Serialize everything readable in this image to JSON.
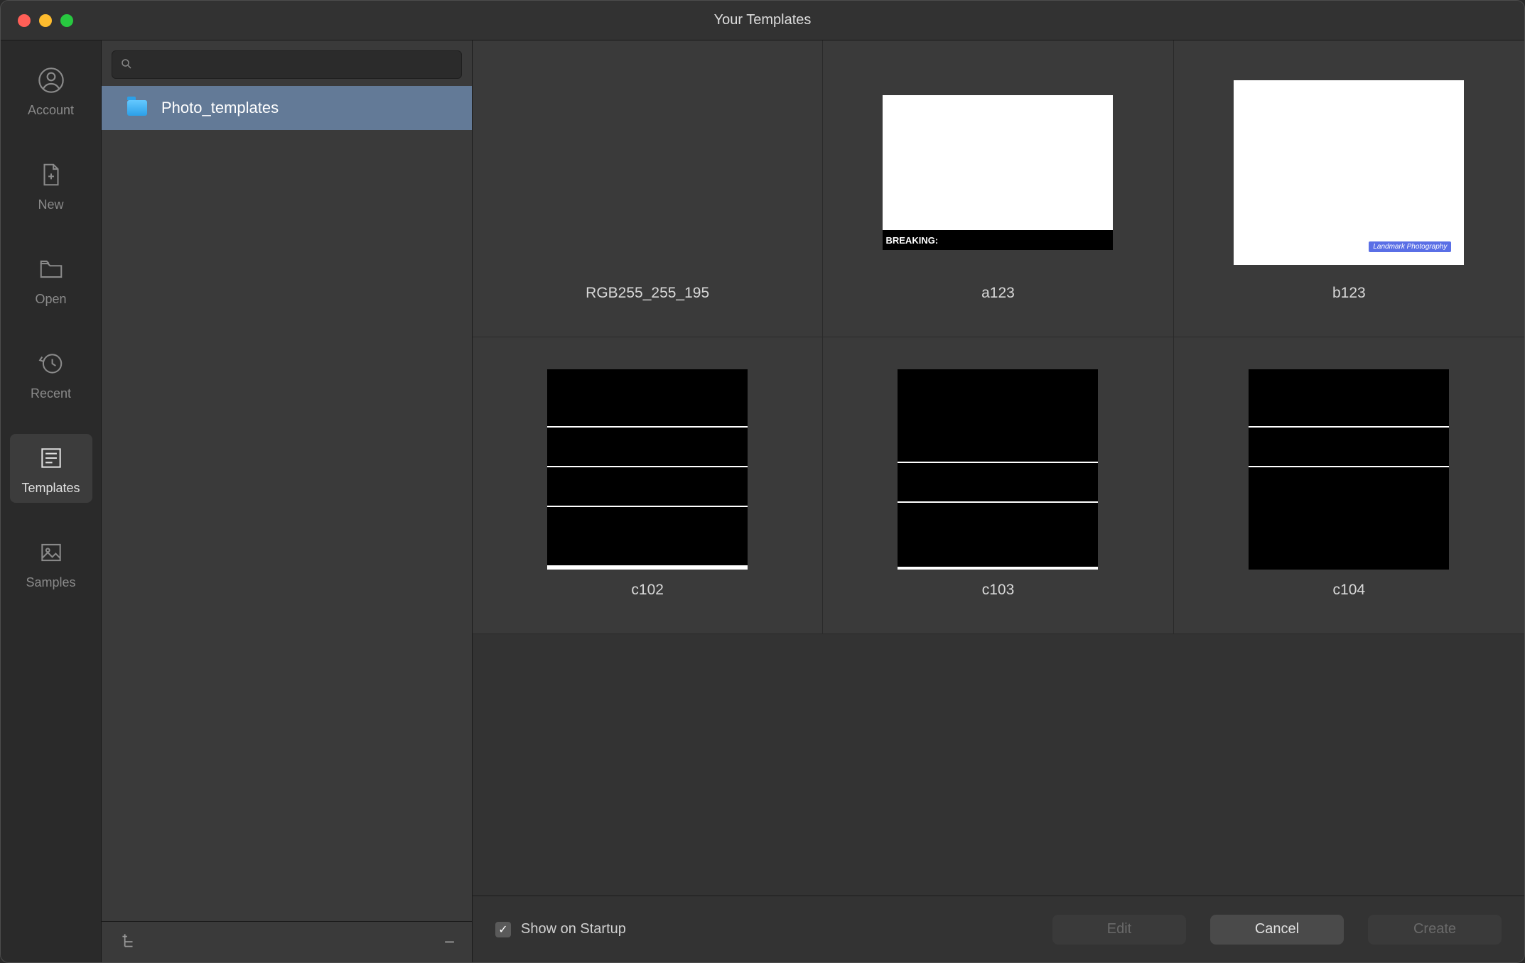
{
  "window": {
    "title": "Your Templates"
  },
  "sidebar": {
    "items": [
      {
        "label": "Account"
      },
      {
        "label": "New"
      },
      {
        "label": "Open"
      },
      {
        "label": "Recent"
      },
      {
        "label": "Templates"
      },
      {
        "label": "Samples"
      }
    ],
    "active_index": 4
  },
  "search": {
    "value": "",
    "placeholder": ""
  },
  "folders": [
    {
      "name": "Photo_templates",
      "selected": true
    }
  ],
  "templates": [
    {
      "name": "RGB255_255_195",
      "kind": "stripe"
    },
    {
      "name": "a123",
      "kind": "breaking",
      "overlay_text": "BREAKING:"
    },
    {
      "name": "b123",
      "kind": "badge",
      "badge_text": "Landmark Photography"
    },
    {
      "name": "c102",
      "kind": "grid-d"
    },
    {
      "name": "c103",
      "kind": "grid-e"
    },
    {
      "name": "c104",
      "kind": "grid-f"
    }
  ],
  "footer": {
    "show_on_startup_label": "Show on Startup",
    "show_on_startup_checked": true,
    "buttons": {
      "edit": "Edit",
      "cancel": "Cancel",
      "create": "Create"
    }
  },
  "icons": {
    "add_folder": "add-tree-icon",
    "remove_folder": "remove-tree-icon"
  }
}
